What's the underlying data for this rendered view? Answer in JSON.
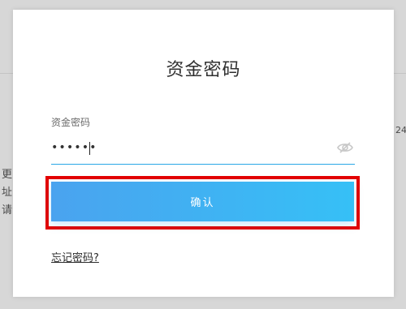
{
  "modal": {
    "title": "资金密码",
    "field_label": "资金密码",
    "password_value": "••••••",
    "confirm_label": "确认",
    "forgot_link": "忘记密码?"
  },
  "background": {
    "left_text_1": "更",
    "left_text_2": "址",
    "left_text_3": "请",
    "right_text": "24"
  },
  "icons": {
    "visibility_toggle": "eye-slash-icon"
  },
  "colors": {
    "input_underline": "#2aa7e6",
    "button_gradient_start": "#4aa3ef",
    "button_gradient_end": "#36c0f6",
    "highlight_outline": "#e40000"
  }
}
